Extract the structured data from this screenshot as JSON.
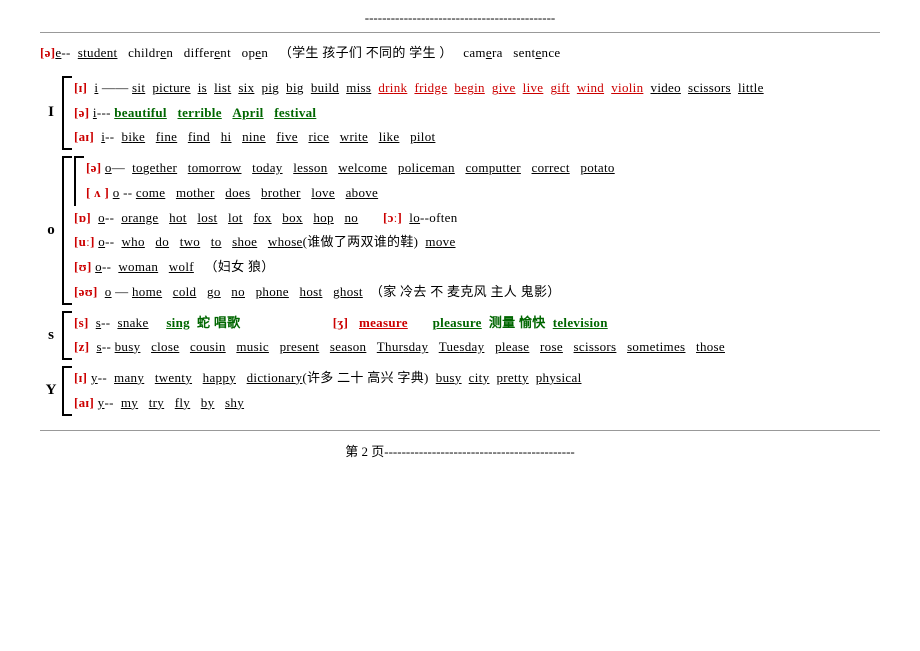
{
  "top_dashes": "--------------------------------------------",
  "top_row": {
    "phonetic": "[ə]",
    "connector": "e--",
    "words": "student   children   different   open（学生 孩子们 不同的 学生） camera   sentence"
  },
  "sections": {
    "I_label": "I",
    "I_rows": [
      {
        "phonetic": "[ɪ]",
        "connector": "i ——",
        "black_words": "sit  picture  is  list  six  pig  big  build  miss ",
        "red_words": "drink fridge begin give live gift wind violin",
        "more_black": " video scissors little"
      },
      {
        "phonetic": "[ə]",
        "connector": "i---",
        "colored_words": "beautiful   terrible   April   festival",
        "color": "green"
      },
      {
        "phonetic": "[aɪ]",
        "connector": "i--",
        "words": "bike   fine   find   hi   nine   five   rice   write   like   pilot"
      }
    ],
    "O_label": "o",
    "O_rows": [
      {
        "phonetic": "[ə]",
        "connector": "o—",
        "words": "together   tomorrow   today   lesson   welcome   policeman   computter   correct   potato",
        "sub": true
      },
      {
        "phonetic": "[ ʌ ]",
        "connector": "o --",
        "words": "come   mother   does   brother   love   above",
        "sub": true
      },
      {
        "phonetic": "[ɒ]",
        "connector": "o--",
        "words_black": "orange   hot   lost   lot   fox   box   hop   no",
        "phonetic2": "[ɔː]",
        "connector2": "lo--often"
      },
      {
        "phonetic": "[uː]",
        "connector": "o--",
        "words": "who   do   two   to   shoe   whose(谁做了两双谁的鞋)  move"
      },
      {
        "phonetic": "[ʊ]",
        "connector": "o--",
        "words": "woman   wolf  （妇女 狼）"
      },
      {
        "phonetic": "[əʊ]",
        "connector": "o —",
        "words": "home   cold   go   no   phone   host   ghost（家 冷去 不 麦克风 主人 鬼影）"
      }
    ],
    "S_label": "s",
    "S_rows": [
      {
        "phonetic_red": "[s]",
        "connector": "s--",
        "words_black": "snake",
        "words_green": "   sing 蛇 唱歌",
        "phonetic2_red": "[ʒ]",
        "words2_red": "measure",
        "words2_green": "   pleasure 测量 愉快 television"
      },
      {
        "phonetic": "[z]",
        "connector": "s--",
        "words": "busy   close   cousin   music   present   season   Thursday   Tuesday   please   rose   scissors   sometimes   those"
      }
    ],
    "Y_label": "Y",
    "Y_rows": [
      {
        "phonetic": "[ɪ]",
        "connector": "y--",
        "words_black": "many   twenty   happy   dictionary(许多 二十 高兴 字典)",
        "words_more": "  busy city pretty physical"
      },
      {
        "phonetic": "[aɪ]",
        "connector": "y--",
        "words": "my   try   fly   by   shy"
      }
    ]
  },
  "bottom_dashes": "第 2 页--------------------------------------------"
}
